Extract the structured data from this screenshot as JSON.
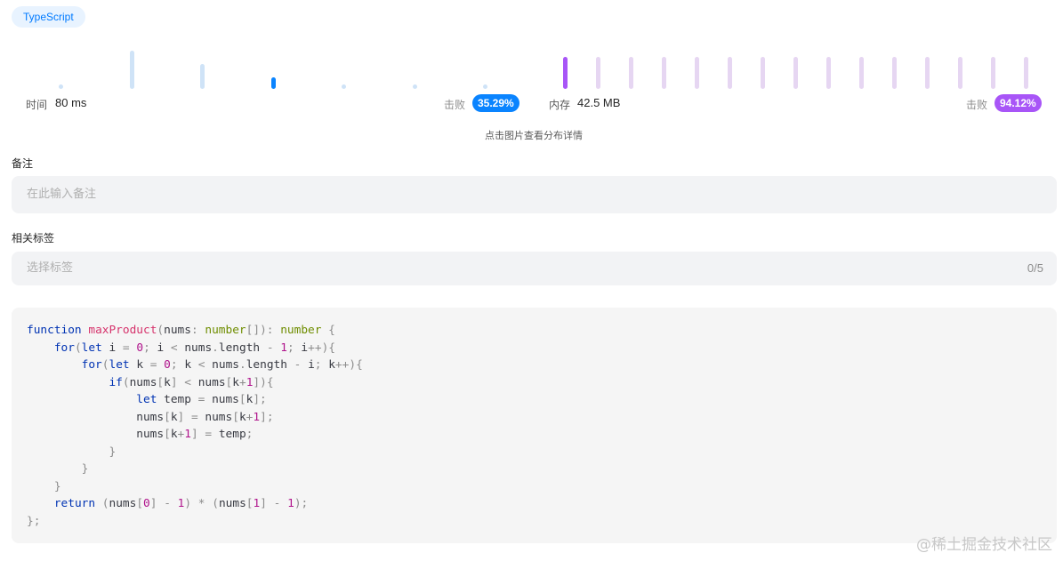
{
  "language_tag": "TypeScript",
  "runtime": {
    "label": "时间",
    "value": "80 ms",
    "beat_label": "击败",
    "beat_percent": "35.29%",
    "accent": "#0a84ff",
    "distribution": [
      0.1,
      1.0,
      0.65,
      0.3,
      0.1,
      0.1,
      0.1
    ],
    "selected_index": 3
  },
  "memory": {
    "label": "内存",
    "value": "42.5 MB",
    "beat_label": "击败",
    "beat_percent": "94.12%",
    "accent": "#a855f7",
    "distribution": [
      1,
      1,
      1,
      1,
      1,
      1,
      1,
      1,
      1,
      1,
      1,
      1,
      1,
      1,
      1
    ],
    "selected_index": 0
  },
  "distribution_hint": "点击图片查看分布详情",
  "notes": {
    "label": "备注",
    "placeholder": "在此输入备注"
  },
  "tags": {
    "label": "相关标签",
    "placeholder": "选择标签",
    "count": "0/5"
  },
  "code": {
    "language": "typescript",
    "lines": [
      "function maxProduct(nums: number[]): number {",
      "    for(let i = 0; i < nums.length - 1; i++){",
      "        for(let k = 0; k < nums.length - i; k++){",
      "            if(nums[k] < nums[k+1]){",
      "                let temp = nums[k];",
      "                nums[k] = nums[k+1];",
      "                nums[k+1] = temp;",
      "            }",
      "        }",
      "    }",
      "    return (nums[0] - 1) * (nums[1] - 1);",
      "};"
    ]
  },
  "watermark": "@稀土掘金技术社区"
}
